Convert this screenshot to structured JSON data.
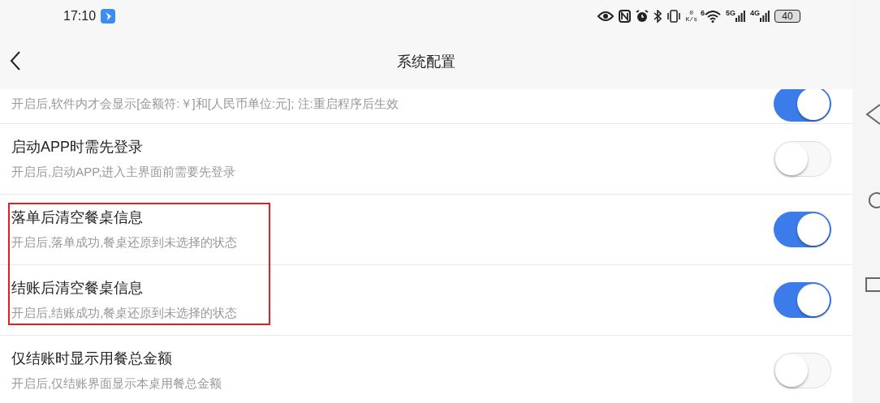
{
  "status_bar": {
    "time": "17:10",
    "net_speed_value": "0",
    "net_speed_unit": "K/s",
    "wifi_badge": "6",
    "network_5g": "5G",
    "network_4g": "4G",
    "battery": "40"
  },
  "header": {
    "title": "系统配置"
  },
  "groups": [
    {
      "highlighted": false,
      "items": [
        {
          "subtitle": "开启后,软件内才会显示[金额符:￥]和[人民币单位:元]; 注:重启程序后生效",
          "on": true
        },
        {
          "title": "启动APP时需先登录",
          "subtitle": "开启后,启动APP,进入主界面前需要先登录",
          "on": false
        }
      ]
    },
    {
      "highlighted": true,
      "items": [
        {
          "title": "落单后清空餐桌信息",
          "subtitle": "开启后,落单成功,餐桌还原到未选择的状态",
          "on": true
        },
        {
          "title": "结账后清空餐桌信息",
          "subtitle": "开启后,结账成功,餐桌还原到未选择的状态",
          "on": true
        }
      ]
    },
    {
      "highlighted": false,
      "items": [
        {
          "title": "仅结账时显示用餐总金额",
          "subtitle": "开启后,仅结账界面显示本桌用餐总金额",
          "on": false
        }
      ]
    }
  ]
}
